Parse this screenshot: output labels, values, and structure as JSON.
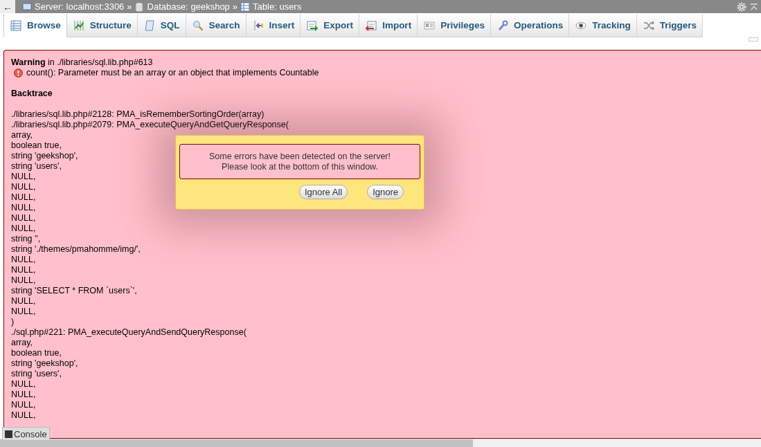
{
  "breadcrumb": {
    "back": "←",
    "separator": "»",
    "items": [
      "Server: localhost:3306",
      "Database: geekshop",
      "Table: users"
    ]
  },
  "tabs": [
    {
      "label": "Browse",
      "selected": true
    },
    {
      "label": "Structure",
      "selected": false
    },
    {
      "label": "SQL",
      "selected": false
    },
    {
      "label": "Search",
      "selected": false
    },
    {
      "label": "Insert",
      "selected": false
    },
    {
      "label": "Export",
      "selected": false
    },
    {
      "label": "Import",
      "selected": false
    },
    {
      "label": "Privileges",
      "selected": false
    },
    {
      "label": "Operations",
      "selected": false
    },
    {
      "label": "Tracking",
      "selected": false
    },
    {
      "label": "Triggers",
      "selected": false
    }
  ],
  "error": {
    "heading": "**Warning** in ./libraries/sql.lib.php#613",
    "message": "count(): Parameter must be an array or an object that implements Countable",
    "backtrace_title": "Backtrace",
    "backtrace": [
      "./libraries/sql.lib.php#2128: PMA_isRememberSortingOrder(array)",
      "./libraries/sql.lib.php#2079: PMA_executeQueryAndGetQueryResponse(",
      "array,",
      "boolean true,",
      "string 'geekshop',",
      "string 'users',",
      "NULL,",
      "NULL,",
      "NULL,",
      "NULL,",
      "NULL,",
      "NULL,",
      "string '',",
      "string './themes/pmahomme/img/',",
      "NULL,",
      "NULL,",
      "NULL,",
      "string 'SELECT * FROM `users`',",
      "NULL,",
      "NULL,",
      ")",
      "./sql.php#221: PMA_executeQueryAndSendQueryResponse(",
      "array,",
      "boolean true,",
      "string 'geekshop',",
      "string 'users',",
      "NULL,",
      "NULL,",
      "NULL,",
      "NULL,"
    ]
  },
  "dialog": {
    "message_lines": [
      "Some errors have been detected on the server!",
      "Please look at the bottom of this window."
    ],
    "buttons": [
      "Ignore All",
      "Ignore"
    ]
  },
  "console": {
    "label": "Console"
  }
}
